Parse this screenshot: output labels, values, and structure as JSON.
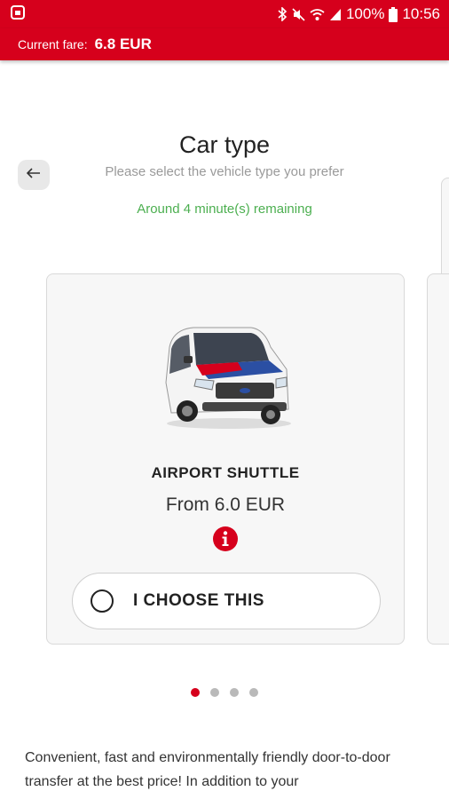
{
  "status_bar": {
    "battery_percent": "100%",
    "time": "10:56",
    "icons": [
      "app-notification-icon",
      "bluetooth-icon",
      "mute-icon",
      "wifi-icon",
      "signal-icon",
      "battery-icon"
    ]
  },
  "fare_bar": {
    "label": "Current fare:",
    "value": "6.8 EUR"
  },
  "header": {
    "title": "Car type",
    "subtitle": "Please select the vehicle type you prefer",
    "remaining": "Around 4 minute(s) remaining",
    "back_icon": "arrow-left-icon"
  },
  "card": {
    "title": "AIRPORT SHUTTLE",
    "price": "From 6.0 EUR",
    "info_icon": "info-icon",
    "choose_label": "I CHOOSE THIS"
  },
  "pager": {
    "count": 4,
    "active_index": 0
  },
  "description": "Convenient, fast and environmentally friendly door-to-door transfer at the best price! In addition to your",
  "colors": {
    "brand": "#d6001c",
    "remaining": "#4caf50",
    "card_bg": "#f7f7f7"
  }
}
